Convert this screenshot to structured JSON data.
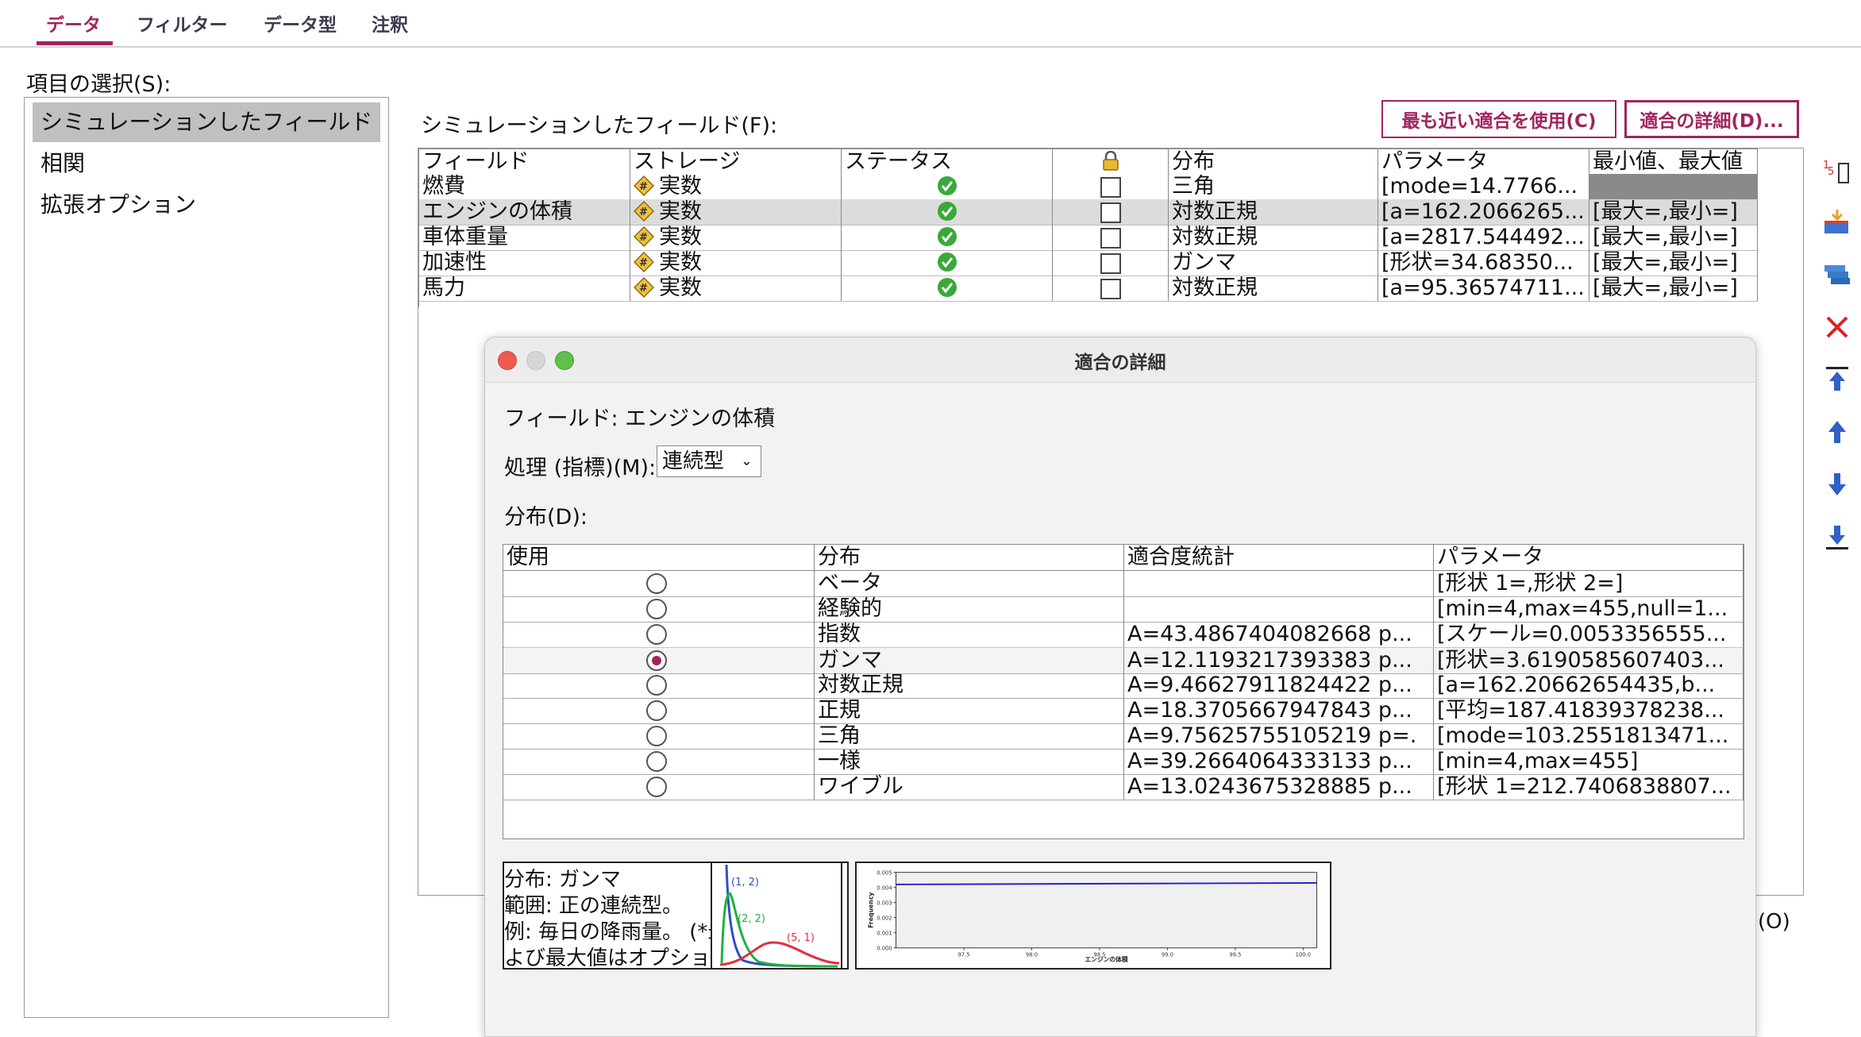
{
  "tabs": [
    {
      "label": "データ"
    },
    {
      "label": "フィルター"
    },
    {
      "label": "データ型"
    },
    {
      "label": "注釈"
    }
  ],
  "item_select_label": "項目の選択(S):",
  "nav": [
    {
      "label": "シミュレーションしたフィールド"
    },
    {
      "label": "相関"
    },
    {
      "label": "拡張オプション"
    }
  ],
  "fields_label": "シミュレーションしたフィールド(F):",
  "buttons": {
    "closest_fit": "最も近い適合を使用(C)",
    "fit_details": "適合の詳細(D)..."
  },
  "fields_table": {
    "headers": [
      "フィールド",
      "ストレージ",
      "ステータス",
      "",
      "分布",
      "パラメータ",
      "最小値、最大値"
    ],
    "rows": [
      {
        "field": "燃費",
        "storage": "実数",
        "dist": "三角",
        "params": "[mode=14.7766...",
        "minmax": ""
      },
      {
        "field": "エンジンの体積",
        "storage": "実数",
        "dist": "対数正規",
        "params": "[a=162.2066265...",
        "minmax": "[最大=,最小=]"
      },
      {
        "field": "車体重量",
        "storage": "実数",
        "dist": "対数正規",
        "params": "[a=2817.544492...",
        "minmax": "[最大=,最小=]"
      },
      {
        "field": "加速性",
        "storage": "実数",
        "dist": "ガンマ",
        "params": "[形状=34.68350...",
        "minmax": "[最大=,最小=]"
      },
      {
        "field": "馬力",
        "storage": "実数",
        "dist": "対数正規",
        "params": "[a=95.36574711...",
        "minmax": "[最大=,最小=]"
      }
    ]
  },
  "side_o": "(O)",
  "dialog": {
    "title": "適合の詳細",
    "field_line": "フィールド: エンジンの体積",
    "measure_label": "処理 (指標)(M):",
    "measure_value": "連続型",
    "dist_label": "分布(D):",
    "headers": [
      "使用",
      "分布",
      "適合度統計",
      "パラメータ"
    ],
    "rows": [
      {
        "name": "ベータ",
        "stat": "",
        "params": "[形状 1=,形状 2=]",
        "selected": false
      },
      {
        "name": "経験的",
        "stat": "",
        "params": "[min=4,max=455,null=1...",
        "selected": false
      },
      {
        "name": "指数",
        "stat": "A=43.4867404082668 p...",
        "params": "[スケール=0.0053356555...",
        "selected": false
      },
      {
        "name": "ガンマ",
        "stat": "A=12.1193217393383 p...",
        "params": "[形状=3.6190585607403...",
        "selected": true
      },
      {
        "name": "対数正規",
        "stat": "A=9.46627911824422 p...",
        "params": "[a=162.20662654435,b...",
        "selected": false
      },
      {
        "name": "正規",
        "stat": "A=18.3705667947843 p...",
        "params": "[平均=187.41839378238...",
        "selected": false
      },
      {
        "name": "三角",
        "stat": "A=9.75625755105219 p=.",
        "params": "[mode=103.2551813471...",
        "selected": false
      },
      {
        "name": "一様",
        "stat": "A=39.2664064333133 p...",
        "params": "[min=4,max=455]",
        "selected": false
      },
      {
        "name": "ワイブル",
        "stat": "A=13.0243675328885 p...",
        "params": "[形状 1=212.7406838807...",
        "selected": false
      }
    ],
    "desc": {
      "line1": "分布: ガンマ",
      "line2": "範囲: 正の連続型。",
      "line3": "例: 毎日の降雨量。 (*最小値お",
      "line4": "よび最大値はオプション。)"
    },
    "thumb_labels": [
      "(1, 2)",
      "(2, 2)",
      "(5, 1)"
    ],
    "colors": {
      "accent": "#a0245e",
      "curve1": "#3050c0",
      "curve2": "#20b040",
      "curve3": "#e03040"
    }
  },
  "chart_data": {
    "type": "line",
    "xlabel": "エンジンの体積",
    "ylabel": "Frequency",
    "x_ticks": [
      "97.5",
      "98.0",
      "98.5",
      "99.0",
      "99.5",
      "100.0"
    ],
    "y_ticks": [
      "0.000",
      "0.001",
      "0.002",
      "0.003",
      "0.004",
      "0.005"
    ],
    "xlim": [
      97.0,
      100.1
    ],
    "ylim": [
      0,
      0.005
    ],
    "series": [
      {
        "x": [
          97.0,
          100.1
        ],
        "y": [
          0.0042,
          0.0043
        ]
      }
    ]
  }
}
